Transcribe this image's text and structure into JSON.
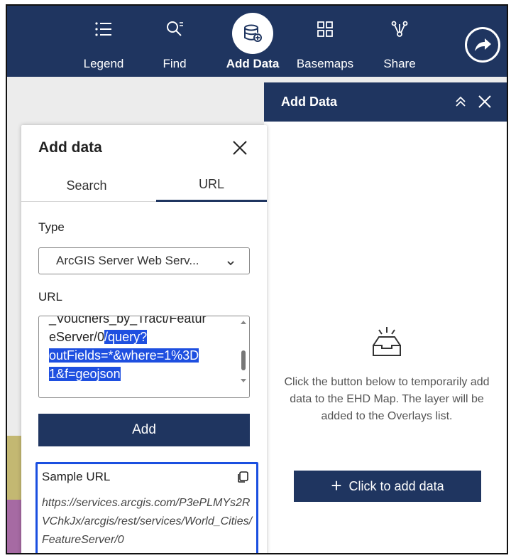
{
  "toolbar": {
    "items": [
      {
        "label": "Legend",
        "icon": "legend-icon"
      },
      {
        "label": "Find",
        "icon": "find-icon"
      },
      {
        "label": "Add Data",
        "icon": "add-data-icon",
        "active": true
      },
      {
        "label": "Basemaps",
        "icon": "basemaps-icon"
      },
      {
        "label": "Share",
        "icon": "share-icon"
      }
    ],
    "extra_icon": "share-arrow-icon",
    "bg_color": "#1f3560"
  },
  "right_panel": {
    "title": "Add Data",
    "empty_icon": "empty-inbox-icon",
    "message": "Click the button below to temporarily add data to the EHD Map. The layer will be added to the Overlays list.",
    "button_label": "Click to add data"
  },
  "dialog": {
    "title": "Add data",
    "tabs": [
      {
        "label": "Search",
        "active": false
      },
      {
        "label": "URL",
        "active": true
      }
    ],
    "type_label": "Type",
    "type_value": "ArcGIS Server Web Serv...",
    "url_label": "URL",
    "url_lines": {
      "line0": "_Vouchers_by_Tract/Featur",
      "line1_plain": "eServer/0",
      "line1_selected": "/query?",
      "line2_selected": "outFields=*&where=1%3D",
      "line3_selected": "1&f=geojson"
    },
    "add_label": "Add",
    "sample": {
      "title": "Sample URL",
      "url": "https://services.arcgis.com/P3ePLMYs2RVChkJx/arcgis/rest/services/World_Cities/FeatureServer/0"
    }
  },
  "colors": {
    "accent": "#1f3560",
    "selection": "#1e4fe0",
    "sample_border": "#1a4fe0"
  }
}
